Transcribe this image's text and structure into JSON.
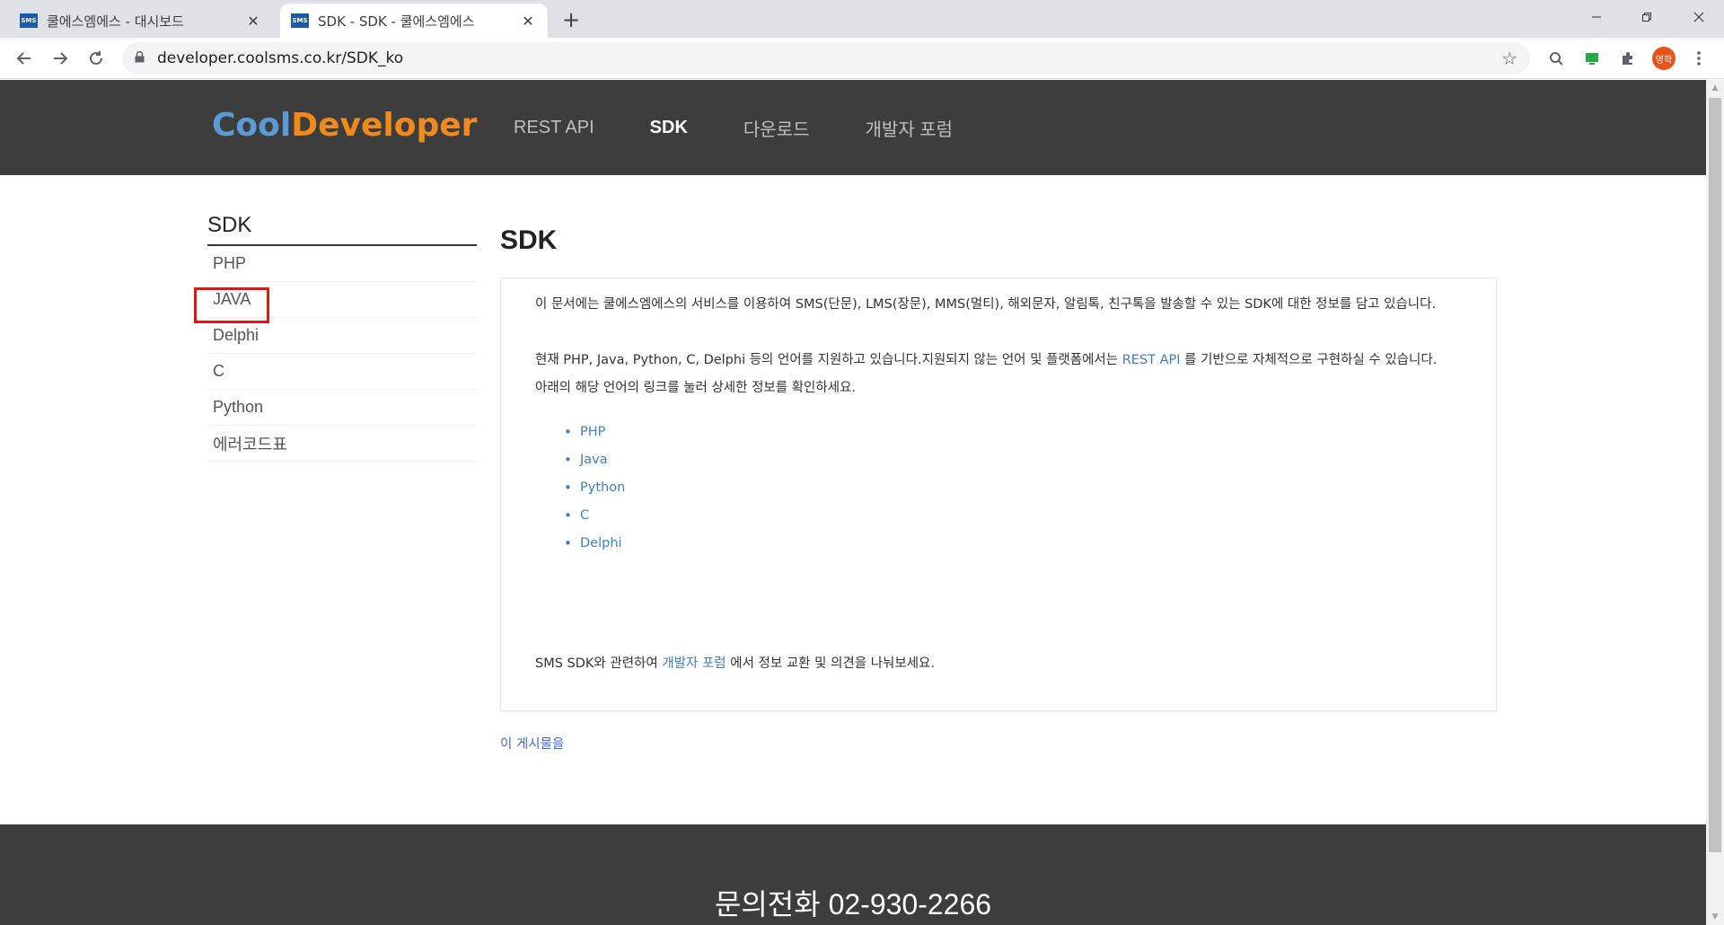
{
  "browser": {
    "tabs": [
      {
        "favicon": "SMS",
        "title": "쿨에스엠에스 - 대시보드",
        "close": "✕"
      },
      {
        "favicon": "SMS",
        "title": "SDK - SDK - 쿨에스엠에스",
        "close": "✕"
      }
    ],
    "new_tab": "+",
    "url": "developer.coolsms.co.kr/SDK_ko",
    "profile": "영학"
  },
  "header": {
    "logo_cool": "Cool",
    "logo_dev": "Developer",
    "nav": [
      "REST API",
      "SDK",
      "다운로드",
      "개발자 포럼"
    ],
    "active_nav": "SDK"
  },
  "sidebar": {
    "title": "SDK",
    "items": [
      "PHP",
      "JAVA",
      "Delphi",
      "C",
      "Python",
      "에러코드표"
    ]
  },
  "content": {
    "title": "SDK",
    "para1": "이 문서에는 쿨에스엠에스의 서비스를 이용하여 SMS(단문), LMS(장문), MMS(멀티), 해외문자, 알림톡, 친구톡을 발송할 수 있는 SDK에 대한 정보를 담고 있습니다.",
    "para2_before": "현재 PHP, Java, Python, C, Delphi 등의  언어를 지원하고 있습니다.지원되지 않는 언어 및 플랫폼에서는 ",
    "para2_link": "REST API",
    "para2_after": " 를 기반으로 자체적으로 구현하실 수 있습니다.",
    "para3": "아래의 해당 언어의 링크를 눌러 상세한 정보를 확인하세요.",
    "languages": [
      "PHP",
      "Java",
      "Python",
      "C",
      "Delphi"
    ],
    "closing_before": "SMS SDK와 관련하여 ",
    "closing_link": "개발자 포럼",
    "closing_after": " 에서 정보 교환 및 의견을  나눠보세요."
  },
  "post_link": "이 게시물을",
  "footer": {
    "phone": "문의전화 02-930-2266"
  },
  "colors": {
    "header_bg": "#3d3d3d",
    "link": "#3f7fbf",
    "highlight": "#e0161b"
  }
}
